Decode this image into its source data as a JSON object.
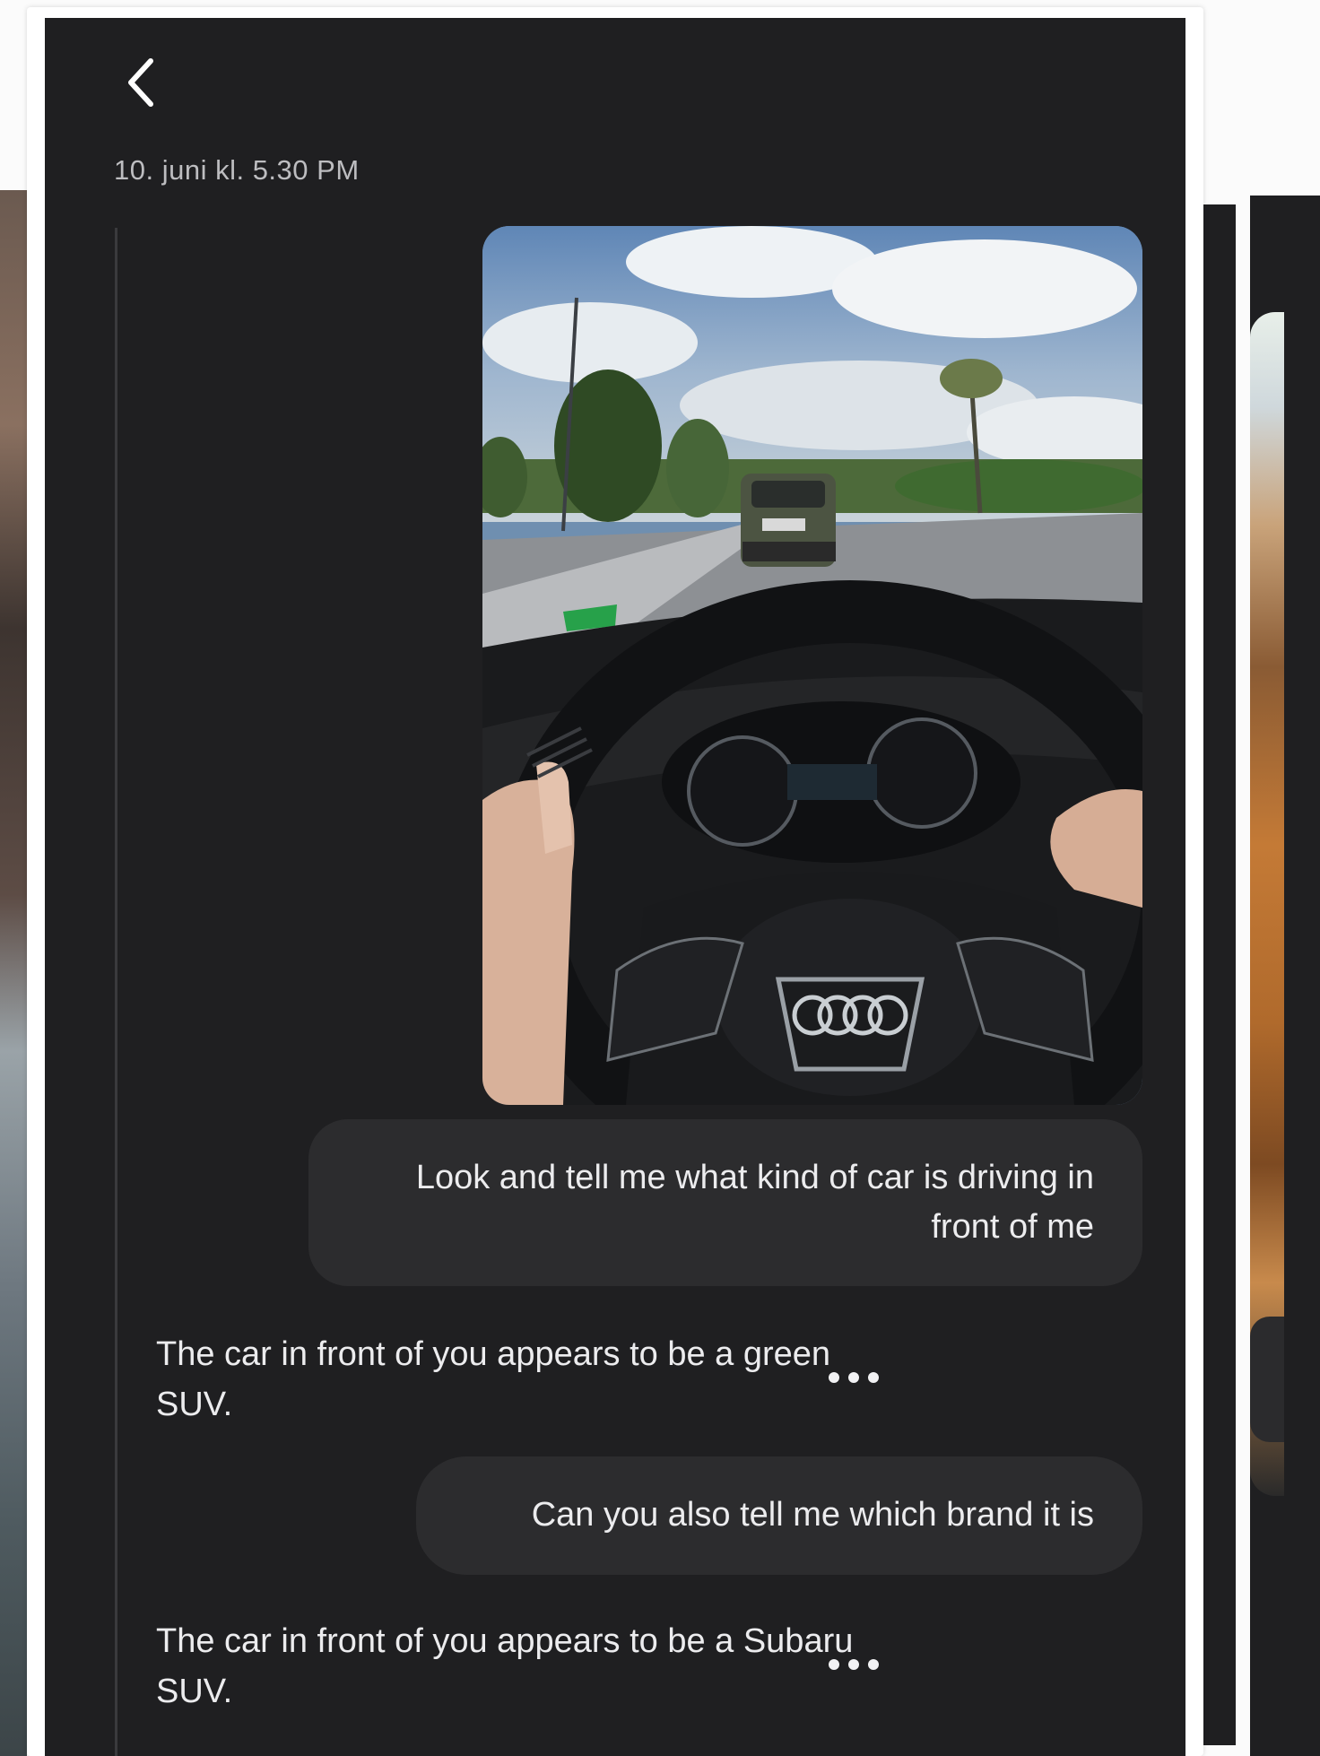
{
  "header": {
    "back_icon": "chevron-left-icon",
    "timestamp": "10. juni kl. 5.30 PM"
  },
  "messages": [
    {
      "role": "user",
      "type": "image",
      "description_icon": "photo"
    },
    {
      "role": "user",
      "text": "Look and tell me what kind of car is driving in front of me"
    },
    {
      "role": "assistant",
      "text": "The car in front of you appears to be a green SUV.",
      "more_icon": "more-dots-icon"
    },
    {
      "role": "user",
      "text": "Can you also tell me which brand it is"
    },
    {
      "role": "assistant",
      "text": "The car in front of you appears to be a Subaru SUV.",
      "more_icon": "more-dots-icon"
    }
  ],
  "colors": {
    "screen_bg": "#1f1f21",
    "bubble_bg": "#2c2c2e",
    "text": "#ececee",
    "muted_text": "#bdbdc0"
  }
}
